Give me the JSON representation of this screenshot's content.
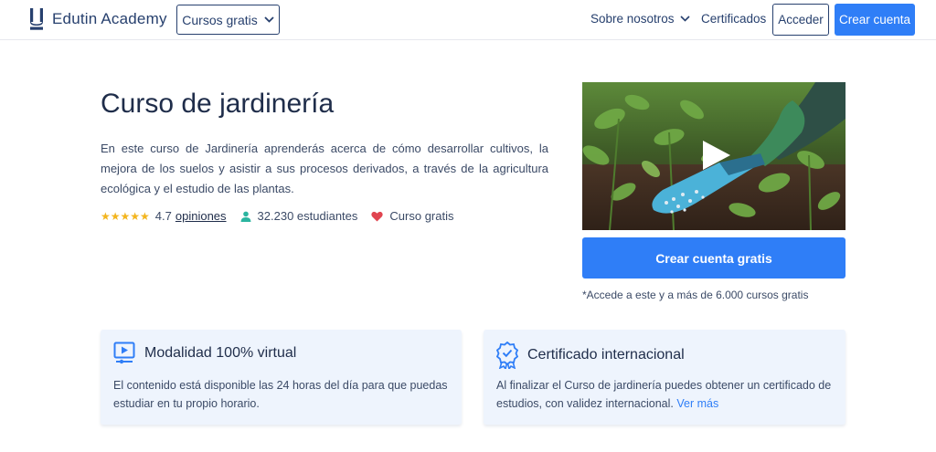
{
  "header": {
    "brand": "Edutin Academy",
    "courses_dropdown": "Cursos gratis",
    "about": "Sobre nosotros",
    "certificates": "Certificados",
    "login": "Acceder",
    "signup": "Crear cuenta"
  },
  "course": {
    "title": "Curso de jardinería",
    "description": "En este curso de Jardinería aprenderás acerca de cómo desarrollar cultivos, la mejora de los suelos y asistir a sus procesos derivados, a través de la agricultura ecológica y el estudio de las plantas.",
    "rating": "4.7",
    "rating_value": 4.7,
    "reviews_label": "opiniones",
    "students": "32.230 estudiantes",
    "price_label": "Curso gratis"
  },
  "cta": {
    "button": "Crear cuenta gratis",
    "note": "*Accede a este y a más de 6.000 cursos gratis"
  },
  "features": [
    {
      "icon": "video-lesson-icon",
      "title": "Modalidad 100% virtual",
      "text": "El contenido está disponible las 24 horas del día para que puedas estudiar en tu propio horario."
    },
    {
      "icon": "certificate-badge-icon",
      "title": "Certificado internacional",
      "text": "Al finalizar el Curso de jardinería puedes obtener un certificado de estudios, con validez internacional.",
      "link": "Ver más"
    }
  ],
  "colors": {
    "primary": "#2f7ef7",
    "navy": "#27406e",
    "star": "#f3b51e",
    "student": "#2bb5a0",
    "heart": "#e04550",
    "card_bg": "#eef4fd"
  }
}
